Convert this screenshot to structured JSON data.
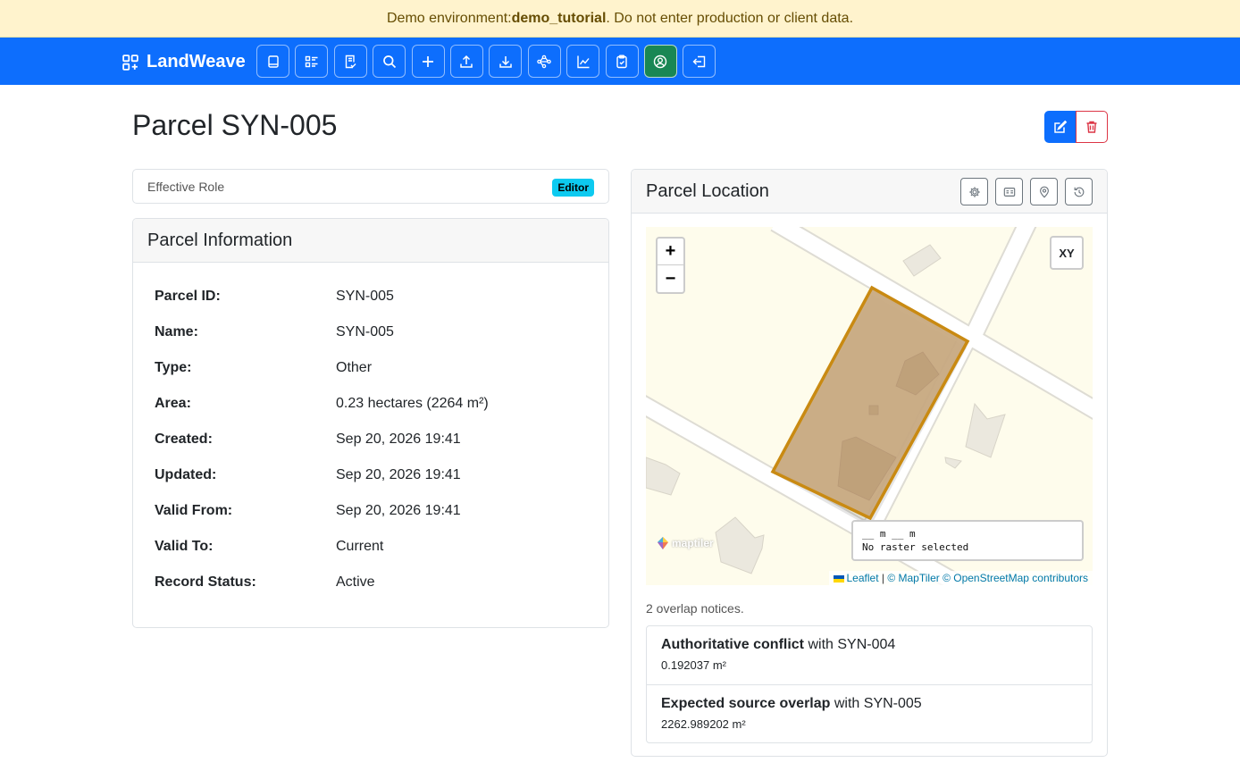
{
  "banner": {
    "prefix": "Demo environment: ",
    "env": "demo_tutorial",
    "suffix": ". Do not enter production or client data."
  },
  "nav": {
    "brand": "LandWeave",
    "buttons": [
      {
        "icon": "book-icon"
      },
      {
        "icon": "list-icon"
      },
      {
        "icon": "checklist-icon"
      },
      {
        "icon": "search-icon"
      },
      {
        "icon": "plus-icon"
      },
      {
        "icon": "upload-icon"
      },
      {
        "icon": "download-icon"
      },
      {
        "icon": "share-nodes-icon"
      },
      {
        "icon": "chart-icon"
      },
      {
        "icon": "clipboard-icon"
      },
      {
        "icon": "user-circle-icon",
        "active": true
      },
      {
        "icon": "sign-out-icon"
      }
    ]
  },
  "page": {
    "title": "Parcel SYN-005"
  },
  "role": {
    "label": "Effective Role",
    "badge": "Editor"
  },
  "info": {
    "header": "Parcel Information",
    "rows": [
      {
        "label": "Parcel ID:",
        "value": "SYN-005"
      },
      {
        "label": "Name:",
        "value": "SYN-005"
      },
      {
        "label": "Type:",
        "value": "Other"
      },
      {
        "label": "Area:",
        "value": "0.23 hectares (2264 m²)"
      },
      {
        "label": "Created:",
        "value": "Sep 20, 2026 19:41"
      },
      {
        "label": "Updated:",
        "value": "Sep 20, 2026 19:41"
      },
      {
        "label": "Valid From:",
        "value": "Sep 20, 2026 19:41"
      },
      {
        "label": "Valid To:",
        "value": "Current"
      },
      {
        "label": "Record Status:",
        "value": "Active"
      }
    ]
  },
  "location": {
    "header": "Parcel Location",
    "tools": [
      "gear-icon",
      "id-card-icon",
      "map-pin-icon",
      "history-icon"
    ],
    "map": {
      "zoom_in": "+",
      "zoom_out": "−",
      "xy_button": "XY",
      "coords_line1": "__ m __ m",
      "coords_line2": "No raster selected",
      "logo_text": "maptiler",
      "attribution_leaflet": "Leaflet",
      "attribution_sep": " | ",
      "attribution_maptiler": "© MapTiler",
      "attribution_osm": "© OpenStreetMap contributors",
      "parcel_fill": "#c8aa82",
      "parcel_stroke": "#c98a12"
    },
    "overlap_count": "2 overlap notices.",
    "overlaps": [
      {
        "kind": "Authoritative conflict",
        "with": " with SYN-004",
        "area": "0.192037 m²"
      },
      {
        "kind": "Expected source overlap",
        "with": " with SYN-005",
        "area": "2262.989202 m²"
      }
    ]
  }
}
